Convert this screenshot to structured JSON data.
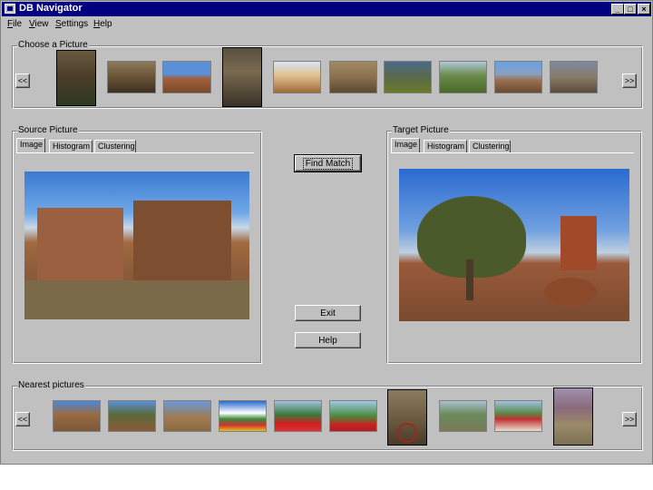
{
  "window": {
    "title": "DB Navigator"
  },
  "menu": [
    "File",
    "View",
    "Settings",
    "Help"
  ],
  "choose_group": {
    "label": "Choose a Picture",
    "prev_label": "<<",
    "next_label": ">>"
  },
  "source_group": {
    "label": "Source Picture",
    "tabs": [
      "Image",
      "Histogram",
      "Clustering"
    ]
  },
  "target_group": {
    "label": "Target Picture",
    "tabs": [
      "Image",
      "Histogram",
      "Clustering"
    ]
  },
  "buttons": {
    "find_match": "Find Match",
    "exit": "Exit",
    "help": "Help"
  },
  "nearest_group": {
    "label": "Nearest pictures",
    "prev_label": "<<",
    "next_label": ">>"
  },
  "colors": {
    "window_face": "#c0c0c0",
    "title_bar": "#000080",
    "sky": "#4a88d8",
    "rock": "#8a5a3a",
    "desert": "#b07a50",
    "foliage": "#4f6a2a",
    "flowers": "#d02020"
  }
}
